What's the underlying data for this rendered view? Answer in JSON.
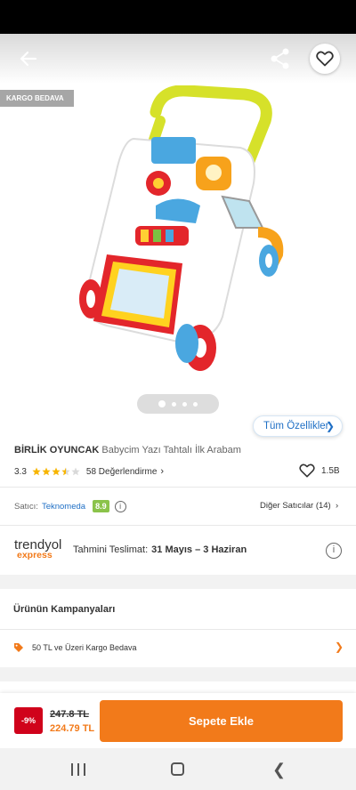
{
  "header": {
    "back_icon": "arrow-left-icon",
    "share_icon": "share-icon",
    "favorite_icon": "heart-icon"
  },
  "gallery": {
    "cargo_badge": "KARGO BEDAVA",
    "image_count": 4,
    "active_index": 0,
    "features_label": "Tüm Özellikler"
  },
  "product": {
    "brand": "BİRLİK OYUNCAK",
    "name": "Babycim Yazı Tahtalı İlk Arabam",
    "rating": "3.3",
    "rating_value": 3.3,
    "review_count": "58 Değerlendirme",
    "likes": "1.5B"
  },
  "seller": {
    "label": "Satıcı:",
    "name": "Teknomeda",
    "score": "8.9",
    "other_sellers": "Diğer Satıcılar (14)"
  },
  "delivery": {
    "logo_top": "trendyol",
    "logo_bottom": "express",
    "label": "Tahmini Teslimat:",
    "dates": "31 Mayıs – 3 Haziran"
  },
  "campaigns": {
    "title": "Ürünün Kampanyaları",
    "items": [
      {
        "label": "50 TL ve Üzeri Kargo Bedava"
      }
    ]
  },
  "cart": {
    "discount": "-9%",
    "old_price": "247.8 TL",
    "new_price": "224.79 TL",
    "add_label": "Sepete Ekle"
  },
  "colors": {
    "accent": "#f27a1a",
    "link": "#1f6fc5",
    "discount": "#d0021b",
    "score": "#8bc34a"
  }
}
